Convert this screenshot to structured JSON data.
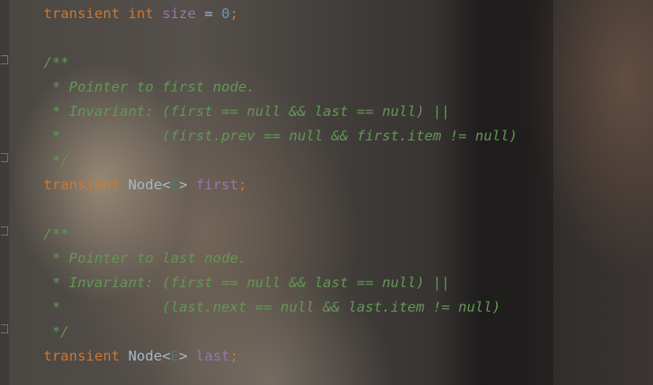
{
  "code": {
    "line1": {
      "kw": "transient",
      "type": "int",
      "name": "size",
      "eq": "=",
      "value": "0",
      "semi": ";"
    },
    "doc1": {
      "open": "/**",
      "l1": " * Pointer to first node.",
      "l2": " * Invariant: (first == null && last == null) ||",
      "l3": " *            (first.prev == null && first.item != null)",
      "close": " */"
    },
    "line2": {
      "kw": "transient",
      "type": "Node",
      "lt": "<",
      "gen": "E",
      "gt": ">",
      "name": "first",
      "semi": ";"
    },
    "doc2": {
      "open": "/**",
      "l1": " * Pointer to last node.",
      "l2": " * Invariant: (first == null && last == null) ||",
      "l3": " *            (last.next == null && last.item != null)",
      "close": " */"
    },
    "line3": {
      "kw": "transient",
      "type": "Node",
      "lt": "<",
      "gen": "E",
      "gt": ">",
      "name": "last",
      "semi": ";"
    }
  },
  "colors": {
    "keyword": "#cc7832",
    "identifier": "#a9b7c6",
    "field": "#9876aa",
    "number": "#6897bb",
    "doc_comment": "#629755",
    "generic": "#507874"
  }
}
